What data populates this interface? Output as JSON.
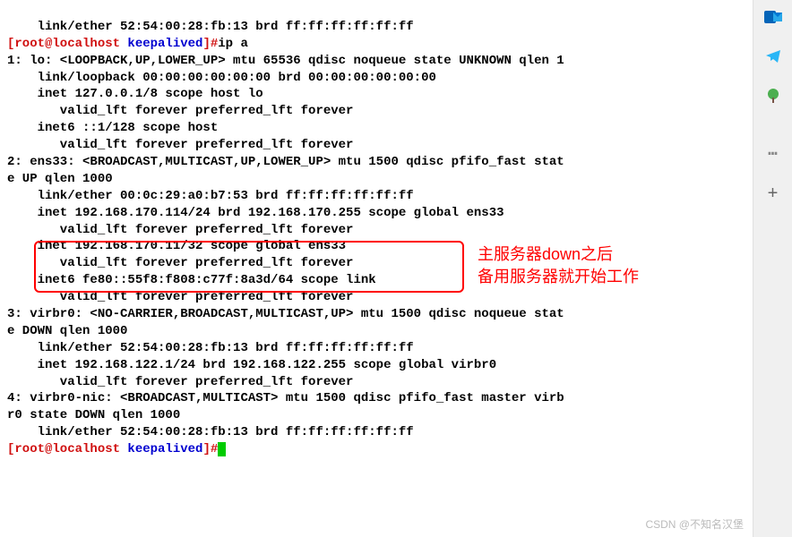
{
  "terminal": {
    "line0": "    link/ether 52:54:00:28:fb:13 brd ff:ff:ff:ff:ff:ff",
    "prompt1_user": "[root@localhost ",
    "prompt1_path": "keepalived",
    "prompt1_close": "]#",
    "cmd1": "ip a",
    "line2": "1: lo: <LOOPBACK,UP,LOWER_UP> mtu 65536 qdisc noqueue state UNKNOWN qlen 1",
    "line3": "    link/loopback 00:00:00:00:00:00 brd 00:00:00:00:00:00",
    "line4": "    inet 127.0.0.1/8 scope host lo",
    "line5": "       valid_lft forever preferred_lft forever",
    "line6": "    inet6 ::1/128 scope host",
    "line7": "       valid_lft forever preferred_lft forever",
    "line8": "2: ens33: <BROADCAST,MULTICAST,UP,LOWER_UP> mtu 1500 qdisc pfifo_fast stat",
    "line9": "e UP qlen 1000",
    "line10": "    link/ether 00:0c:29:a0:b7:53 brd ff:ff:ff:ff:ff:ff",
    "line11": "    inet 192.168.170.114/24 brd 192.168.170.255 scope global ens33",
    "line12": "       valid_lft forever preferred_lft forever",
    "line13": "    inet 192.168.170.11/32 scope global ens33",
    "line14": "       valid_lft forever preferred_lft forever",
    "line15": "    inet6 fe80::55f8:f808:c77f:8a3d/64 scope link",
    "line16": "       valid_lft forever preferred_lft forever",
    "line17": "3: virbr0: <NO-CARRIER,BROADCAST,MULTICAST,UP> mtu 1500 qdisc noqueue stat",
    "line18": "e DOWN qlen 1000",
    "line19": "    link/ether 52:54:00:28:fb:13 brd ff:ff:ff:ff:ff:ff",
    "line20": "    inet 192.168.122.1/24 brd 192.168.122.255 scope global virbr0",
    "line21": "       valid_lft forever preferred_lft forever",
    "line22": "4: virbr0-nic: <BROADCAST,MULTICAST> mtu 1500 qdisc pfifo_fast master virb",
    "line23": "r0 state DOWN qlen 1000",
    "line24": "    link/ether 52:54:00:28:fb:13 brd ff:ff:ff:ff:ff:ff",
    "prompt2_user": "[root@localhost ",
    "prompt2_path": "keepalived",
    "prompt2_close": "]#"
  },
  "annotation": {
    "text_line1": "主服务器down之后",
    "text_line2": "备用服务器就开始工作"
  },
  "watermark": "CSDN @不知名汉堡"
}
